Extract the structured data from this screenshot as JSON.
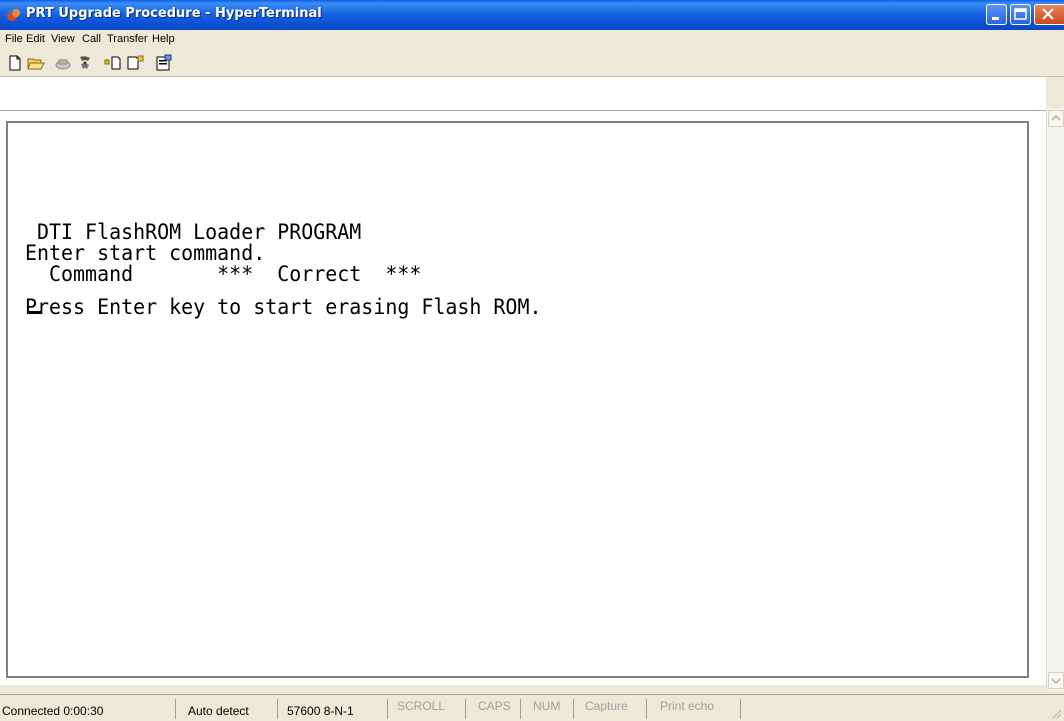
{
  "window": {
    "title": "PRT Upgrade Procedure - HyperTerminal",
    "accent_color": "#0a5ee8"
  },
  "menu": {
    "items": [
      "File",
      "Edit",
      "View",
      "Call",
      "Transfer",
      "Help"
    ]
  },
  "toolbar": {
    "buttons": [
      "new-connection-icon",
      "open-icon",
      "disconnect-icon",
      "dial-icon",
      "send-icon",
      "receive-icon",
      "properties-icon"
    ]
  },
  "terminal": {
    "lines": [
      " DTI FlashROM Loader PROGRAM",
      "Enter start command.",
      "  Command       ***  Correct  ***",
      "",
      "Press Enter key to start erasing Flash ROM."
    ]
  },
  "statusbar": {
    "connected": "Connected 0:00:30",
    "detect": "Auto detect",
    "settings": "57600 8-N-1",
    "scroll": "SCROLL",
    "caps": "CAPS",
    "num": "NUM",
    "capture": "Capture",
    "print_echo": "Print echo"
  }
}
